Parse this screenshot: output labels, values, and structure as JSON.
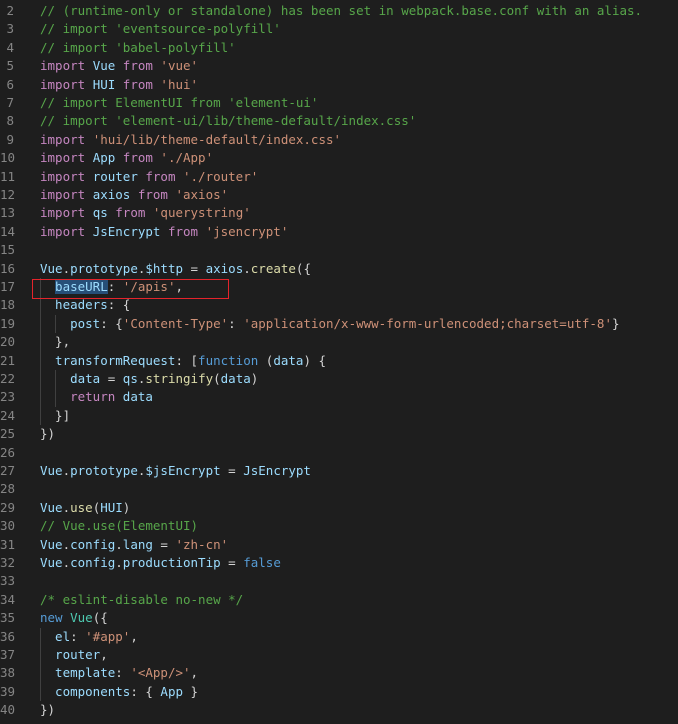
{
  "editor": {
    "lines": [
      {
        "n": "2",
        "indent": 0,
        "tokens": [
          {
            "t": "// (runtime-only or standalone) has been set in webpack.base.conf with an alias.",
            "c": "t-comment"
          }
        ]
      },
      {
        "n": "3",
        "indent": 0,
        "tokens": [
          {
            "t": "// import 'eventsource-polyfill'",
            "c": "t-comment"
          }
        ]
      },
      {
        "n": "4",
        "indent": 0,
        "tokens": [
          {
            "t": "// import 'babel-polyfill'",
            "c": "t-comment"
          }
        ]
      },
      {
        "n": "5",
        "indent": 0,
        "tokens": [
          {
            "t": "import",
            "c": "t-control"
          },
          {
            "t": " ",
            "c": "t-punc"
          },
          {
            "t": "Vue",
            "c": "t-ident"
          },
          {
            "t": " from ",
            "c": "t-control"
          },
          {
            "t": "'vue'",
            "c": "t-string"
          }
        ]
      },
      {
        "n": "6",
        "indent": 0,
        "tokens": [
          {
            "t": "import",
            "c": "t-control"
          },
          {
            "t": " ",
            "c": "t-punc"
          },
          {
            "t": "HUI",
            "c": "t-ident"
          },
          {
            "t": " from ",
            "c": "t-control"
          },
          {
            "t": "'hui'",
            "c": "t-string"
          }
        ]
      },
      {
        "n": "7",
        "indent": 0,
        "tokens": [
          {
            "t": "// import ElementUI from 'element-ui'",
            "c": "t-comment"
          }
        ]
      },
      {
        "n": "8",
        "indent": 0,
        "tokens": [
          {
            "t": "// import 'element-ui/lib/theme-default/index.css'",
            "c": "t-comment"
          }
        ]
      },
      {
        "n": "9",
        "indent": 0,
        "tokens": [
          {
            "t": "import",
            "c": "t-control"
          },
          {
            "t": " ",
            "c": "t-punc"
          },
          {
            "t": "'hui/lib/theme-default/index.css'",
            "c": "t-string"
          }
        ]
      },
      {
        "n": "10",
        "indent": 0,
        "tokens": [
          {
            "t": "import",
            "c": "t-control"
          },
          {
            "t": " ",
            "c": "t-punc"
          },
          {
            "t": "App",
            "c": "t-ident"
          },
          {
            "t": " from ",
            "c": "t-control"
          },
          {
            "t": "'./App'",
            "c": "t-string"
          }
        ]
      },
      {
        "n": "11",
        "indent": 0,
        "tokens": [
          {
            "t": "import",
            "c": "t-control"
          },
          {
            "t": " ",
            "c": "t-punc"
          },
          {
            "t": "router",
            "c": "t-ident"
          },
          {
            "t": " from ",
            "c": "t-control"
          },
          {
            "t": "'./router'",
            "c": "t-string"
          }
        ]
      },
      {
        "n": "12",
        "indent": 0,
        "tokens": [
          {
            "t": "import",
            "c": "t-control"
          },
          {
            "t": " ",
            "c": "t-punc"
          },
          {
            "t": "axios",
            "c": "t-ident"
          },
          {
            "t": " from ",
            "c": "t-control"
          },
          {
            "t": "'axios'",
            "c": "t-string"
          }
        ]
      },
      {
        "n": "13",
        "indent": 0,
        "tokens": [
          {
            "t": "import",
            "c": "t-control"
          },
          {
            "t": " ",
            "c": "t-punc"
          },
          {
            "t": "qs",
            "c": "t-ident"
          },
          {
            "t": " from ",
            "c": "t-control"
          },
          {
            "t": "'querystring'",
            "c": "t-string"
          }
        ]
      },
      {
        "n": "14",
        "indent": 0,
        "tokens": [
          {
            "t": "import",
            "c": "t-control"
          },
          {
            "t": " ",
            "c": "t-punc"
          },
          {
            "t": "JsEncrypt",
            "c": "t-ident"
          },
          {
            "t": " from ",
            "c": "t-control"
          },
          {
            "t": "'jsencrypt'",
            "c": "t-string"
          }
        ]
      },
      {
        "n": "15",
        "indent": 0,
        "tokens": []
      },
      {
        "n": "16",
        "indent": 0,
        "tokens": [
          {
            "t": "Vue",
            "c": "t-ident"
          },
          {
            "t": ".",
            "c": "t-punc"
          },
          {
            "t": "prototype",
            "c": "t-ident"
          },
          {
            "t": ".",
            "c": "t-punc"
          },
          {
            "t": "$http",
            "c": "t-ident"
          },
          {
            "t": " = ",
            "c": "t-punc"
          },
          {
            "t": "axios",
            "c": "t-ident"
          },
          {
            "t": ".",
            "c": "t-punc"
          },
          {
            "t": "create",
            "c": "t-func"
          },
          {
            "t": "({",
            "c": "t-punc"
          }
        ]
      },
      {
        "n": "17",
        "indent": 1,
        "tokens": [
          {
            "t": "baseURL",
            "c": "t-sel"
          },
          {
            "t": ": ",
            "c": "t-punc"
          },
          {
            "t": "'/apis'",
            "c": "t-string"
          },
          {
            "t": ",",
            "c": "t-punc"
          }
        ]
      },
      {
        "n": "18",
        "indent": 1,
        "tokens": [
          {
            "t": "headers",
            "c": "t-ident"
          },
          {
            "t": ": {",
            "c": "t-punc"
          }
        ]
      },
      {
        "n": "19",
        "indent": 2,
        "tokens": [
          {
            "t": "post",
            "c": "t-ident"
          },
          {
            "t": ": {",
            "c": "t-punc"
          },
          {
            "t": "'Content-Type'",
            "c": "t-string"
          },
          {
            "t": ": ",
            "c": "t-punc"
          },
          {
            "t": "'application/x-www-form-urlencoded;charset=utf-8'",
            "c": "t-string"
          },
          {
            "t": "}",
            "c": "t-punc"
          }
        ]
      },
      {
        "n": "20",
        "indent": 1,
        "tokens": [
          {
            "t": "},",
            "c": "t-punc"
          }
        ]
      },
      {
        "n": "21",
        "indent": 1,
        "tokens": [
          {
            "t": "transformRequest",
            "c": "t-ident"
          },
          {
            "t": ": [",
            "c": "t-punc"
          },
          {
            "t": "function",
            "c": "t-keyword"
          },
          {
            "t": " (",
            "c": "t-punc"
          },
          {
            "t": "data",
            "c": "t-ident"
          },
          {
            "t": ") {",
            "c": "t-punc"
          }
        ]
      },
      {
        "n": "22",
        "indent": 2,
        "tokens": [
          {
            "t": "data",
            "c": "t-ident"
          },
          {
            "t": " = ",
            "c": "t-punc"
          },
          {
            "t": "qs",
            "c": "t-ident"
          },
          {
            "t": ".",
            "c": "t-punc"
          },
          {
            "t": "stringify",
            "c": "t-func"
          },
          {
            "t": "(",
            "c": "t-punc"
          },
          {
            "t": "data",
            "c": "t-ident"
          },
          {
            "t": ")",
            "c": "t-punc"
          }
        ]
      },
      {
        "n": "23",
        "indent": 2,
        "tokens": [
          {
            "t": "return",
            "c": "t-control"
          },
          {
            "t": " ",
            "c": "t-punc"
          },
          {
            "t": "data",
            "c": "t-ident"
          }
        ]
      },
      {
        "n": "24",
        "indent": 1,
        "tokens": [
          {
            "t": "}]",
            "c": "t-punc"
          }
        ]
      },
      {
        "n": "25",
        "indent": 0,
        "tokens": [
          {
            "t": "})",
            "c": "t-punc"
          }
        ]
      },
      {
        "n": "26",
        "indent": 0,
        "tokens": []
      },
      {
        "n": "27",
        "indent": 0,
        "tokens": [
          {
            "t": "Vue",
            "c": "t-ident"
          },
          {
            "t": ".",
            "c": "t-punc"
          },
          {
            "t": "prototype",
            "c": "t-ident"
          },
          {
            "t": ".",
            "c": "t-punc"
          },
          {
            "t": "$jsEncrypt",
            "c": "t-ident"
          },
          {
            "t": " = ",
            "c": "t-punc"
          },
          {
            "t": "JsEncrypt",
            "c": "t-ident"
          }
        ]
      },
      {
        "n": "28",
        "indent": 0,
        "tokens": []
      },
      {
        "n": "29",
        "indent": 0,
        "tokens": [
          {
            "t": "Vue",
            "c": "t-ident"
          },
          {
            "t": ".",
            "c": "t-punc"
          },
          {
            "t": "use",
            "c": "t-func"
          },
          {
            "t": "(",
            "c": "t-punc"
          },
          {
            "t": "HUI",
            "c": "t-ident"
          },
          {
            "t": ")",
            "c": "t-punc"
          }
        ]
      },
      {
        "n": "30",
        "indent": 0,
        "tokens": [
          {
            "t": "// Vue.use(ElementUI)",
            "c": "t-comment"
          }
        ]
      },
      {
        "n": "31",
        "indent": 0,
        "tokens": [
          {
            "t": "Vue",
            "c": "t-ident"
          },
          {
            "t": ".",
            "c": "t-punc"
          },
          {
            "t": "config",
            "c": "t-ident"
          },
          {
            "t": ".",
            "c": "t-punc"
          },
          {
            "t": "lang",
            "c": "t-ident"
          },
          {
            "t": " = ",
            "c": "t-punc"
          },
          {
            "t": "'zh-cn'",
            "c": "t-string"
          }
        ]
      },
      {
        "n": "32",
        "indent": 0,
        "tokens": [
          {
            "t": "Vue",
            "c": "t-ident"
          },
          {
            "t": ".",
            "c": "t-punc"
          },
          {
            "t": "config",
            "c": "t-ident"
          },
          {
            "t": ".",
            "c": "t-punc"
          },
          {
            "t": "productionTip",
            "c": "t-ident"
          },
          {
            "t": " = ",
            "c": "t-punc"
          },
          {
            "t": "false",
            "c": "t-keyword"
          }
        ]
      },
      {
        "n": "33",
        "indent": 0,
        "tokens": []
      },
      {
        "n": "34",
        "indent": 0,
        "tokens": [
          {
            "t": "/* eslint-disable no-new */",
            "c": "t-comment"
          }
        ]
      },
      {
        "n": "35",
        "indent": 0,
        "tokens": [
          {
            "t": "new",
            "c": "t-keyword"
          },
          {
            "t": " ",
            "c": "t-punc"
          },
          {
            "t": "Vue",
            "c": "t-type"
          },
          {
            "t": "({",
            "c": "t-punc"
          }
        ]
      },
      {
        "n": "36",
        "indent": 1,
        "tokens": [
          {
            "t": "el",
            "c": "t-ident"
          },
          {
            "t": ": ",
            "c": "t-punc"
          },
          {
            "t": "'#app'",
            "c": "t-string"
          },
          {
            "t": ",",
            "c": "t-punc"
          }
        ]
      },
      {
        "n": "37",
        "indent": 1,
        "tokens": [
          {
            "t": "router",
            "c": "t-ident"
          },
          {
            "t": ",",
            "c": "t-punc"
          }
        ]
      },
      {
        "n": "38",
        "indent": 1,
        "tokens": [
          {
            "t": "template",
            "c": "t-ident"
          },
          {
            "t": ": ",
            "c": "t-punc"
          },
          {
            "t": "'<App/>'",
            "c": "t-string"
          },
          {
            "t": ",",
            "c": "t-punc"
          }
        ]
      },
      {
        "n": "39",
        "indent": 1,
        "tokens": [
          {
            "t": "components",
            "c": "t-ident"
          },
          {
            "t": ": { ",
            "c": "t-punc"
          },
          {
            "t": "App",
            "c": "t-ident"
          },
          {
            "t": " }",
            "c": "t-punc"
          }
        ]
      },
      {
        "n": "40",
        "indent": 0,
        "tokens": [
          {
            "t": "})",
            "c": "t-punc"
          }
        ]
      }
    ]
  },
  "colors": {
    "background": "#1e1e1e",
    "line_number": "#858585",
    "comment": "#57a64a",
    "keyword": "#569cd6",
    "control_keyword": "#c586c0",
    "identifier": "#9cdcfe",
    "string": "#ce9178",
    "function": "#dcdcaa",
    "selection": "#264f78",
    "annotation_box": "#e5242b"
  }
}
